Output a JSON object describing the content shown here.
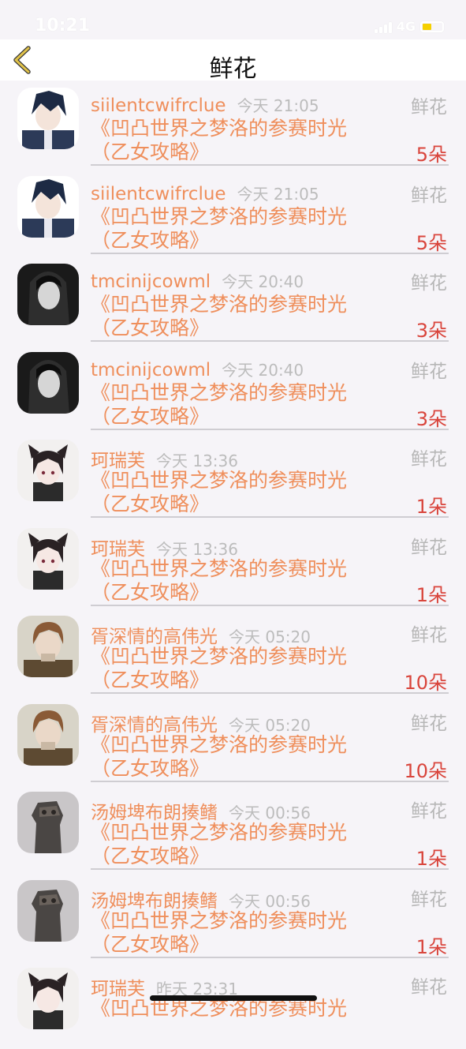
{
  "status_bar": {
    "time": "10:21",
    "network": "4G"
  },
  "nav": {
    "title": "鲜花"
  },
  "items": [
    {
      "name": "siilentcwifrclue",
      "time": "今天 21:05",
      "gift": "鲜花",
      "book_line1": "《凹凸世界之梦洛的参赛时光",
      "book_line2": "（乙女攻略》",
      "count": "5朵",
      "avatar": "boy-dark-hair"
    },
    {
      "name": "siilentcwifrclue",
      "time": "今天 21:05",
      "gift": "鲜花",
      "book_line1": "《凹凸世界之梦洛的参赛时光",
      "book_line2": "（乙女攻略》",
      "count": "5朵",
      "avatar": "boy-dark-hair"
    },
    {
      "name": "tmcinijcowml",
      "time": "今天 20:40",
      "gift": "鲜花",
      "book_line1": "《凹凸世界之梦洛的参赛时光",
      "book_line2": "（乙女攻略》",
      "count": "3朵",
      "avatar": "woman-monochrome"
    },
    {
      "name": "tmcinijcowml",
      "time": "今天 20:40",
      "gift": "鲜花",
      "book_line1": "《凹凸世界之梦洛的参赛时光",
      "book_line2": "（乙女攻略》",
      "count": "3朵",
      "avatar": "woman-monochrome"
    },
    {
      "name": "珂瑞芙",
      "time": "今天 13:36",
      "gift": "鲜花",
      "book_line1": "《凹凸世界之梦洛的参赛时光",
      "book_line2": "（乙女攻略》",
      "count": "1朵",
      "avatar": "girl-cat-ears"
    },
    {
      "name": "珂瑞芙",
      "time": "今天 13:36",
      "gift": "鲜花",
      "book_line1": "《凹凸世界之梦洛的参赛时光",
      "book_line2": "（乙女攻略》",
      "count": "1朵",
      "avatar": "girl-cat-ears"
    },
    {
      "name": "胥深情的高伟光",
      "time": "今天 05:20",
      "gift": "鲜花",
      "book_line1": "《凹凸世界之梦洛的参赛时光",
      "book_line2": "（乙女攻略》",
      "count": "10朵",
      "avatar": "boy-brown-hair"
    },
    {
      "name": "胥深情的高伟光",
      "time": "今天 05:20",
      "gift": "鲜花",
      "book_line1": "《凹凸世界之梦洛的参赛时光",
      "book_line2": "（乙女攻略》",
      "count": "10朵",
      "avatar": "boy-brown-hair"
    },
    {
      "name": "汤姆埤布朗揍鳍",
      "time": "今天 00:56",
      "gift": "鲜花",
      "book_line1": "《凹凸世界之梦洛的参赛时光",
      "book_line2": "（乙女攻略》",
      "count": "1朵",
      "avatar": "bronze-figure"
    },
    {
      "name": "汤姆埤布朗揍鳍",
      "time": "今天 00:56",
      "gift": "鲜花",
      "book_line1": "《凹凸世界之梦洛的参赛时光",
      "book_line2": "（乙女攻略》",
      "count": "1朵",
      "avatar": "bronze-figure"
    },
    {
      "name": "珂瑞芙",
      "time": "昨天 23:31",
      "gift": "鲜花",
      "book_line1": "《凹凸世界之梦洛的参赛时光",
      "book_line2": "",
      "count": "",
      "avatar": "girl-cat-ears"
    }
  ],
  "colors": {
    "accent": "#ef8f5c",
    "count": "#d9453c",
    "muted": "#bcbcbc",
    "background": "#f6f4f8",
    "back_arrow": "#e0c24a"
  }
}
